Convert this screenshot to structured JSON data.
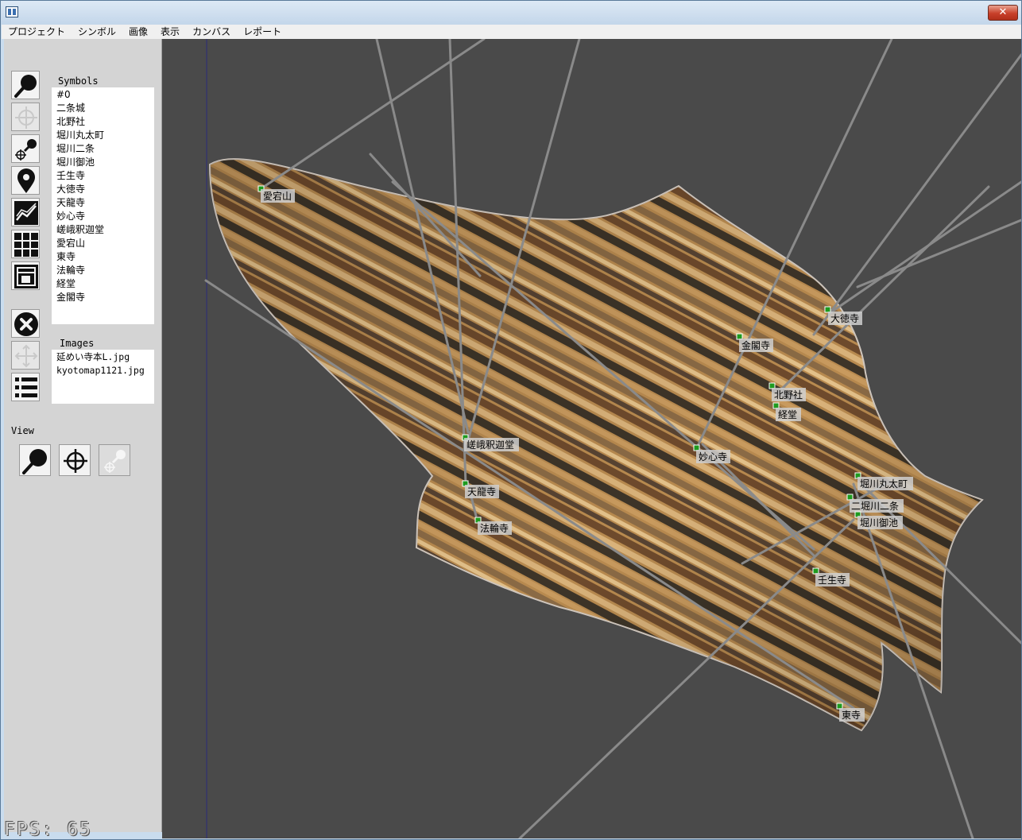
{
  "menu": [
    "プロジェクト",
    "シンボル",
    "画像",
    "表示",
    "カンバス",
    "レポート"
  ],
  "titlebar": {
    "close_glyph": "✕"
  },
  "tools": [
    {
      "name": "zoom-tool-icon"
    },
    {
      "name": "crosshair-tool-icon"
    },
    {
      "name": "zoom-crosshair-tool-icon"
    },
    {
      "name": "map-pin-tool-icon"
    },
    {
      "name": "chart-tool-icon"
    },
    {
      "name": "grid-tool-icon"
    },
    {
      "name": "layout-tool-icon"
    },
    {
      "name": "delete-tool-icon"
    },
    {
      "name": "move-tool-icon"
    },
    {
      "name": "list-tool-icon"
    }
  ],
  "symbols_panel": {
    "label": "Symbols",
    "items": [
      "#0",
      "二条城",
      "北野社",
      "堀川丸太町",
      "堀川二条",
      "堀川御池",
      "壬生寺",
      "大徳寺",
      "天龍寺",
      "妙心寺",
      "嵯峨釈迦堂",
      "愛宕山",
      "東寺",
      "法輪寺",
      "経堂",
      "金閣寺"
    ]
  },
  "images_panel": {
    "label": "Images",
    "items": [
      "延めい寺本L.jpg",
      "kyotomap1121.jpg"
    ]
  },
  "view_panel": {
    "label": "View"
  },
  "fps": {
    "text": "FPS: 65"
  },
  "map_labels": {
    "atagoyama": "愛宕山",
    "daitokuji": "大徳寺",
    "kinkakuji": "金閣寺",
    "kitanosha": "北野社",
    "kyodo": "経堂",
    "myoshinji": "妙心寺",
    "saga_shakado": "嵯峨釈迦堂",
    "tenryuji": "天龍寺",
    "horinji": "法輪寺",
    "horikawa_marutamachi": "堀川丸太町",
    "horikawa_nijo": "二堀川二条",
    "horikawa_oike": "堀川御池",
    "mibudera": "壬生寺",
    "toji": "東寺"
  },
  "colors": {
    "canvas_bg": "#4a4a4a",
    "marker": "#1f9a1f",
    "vector_line": "#8a8a8a",
    "label_bg": "#cfcfcf"
  }
}
